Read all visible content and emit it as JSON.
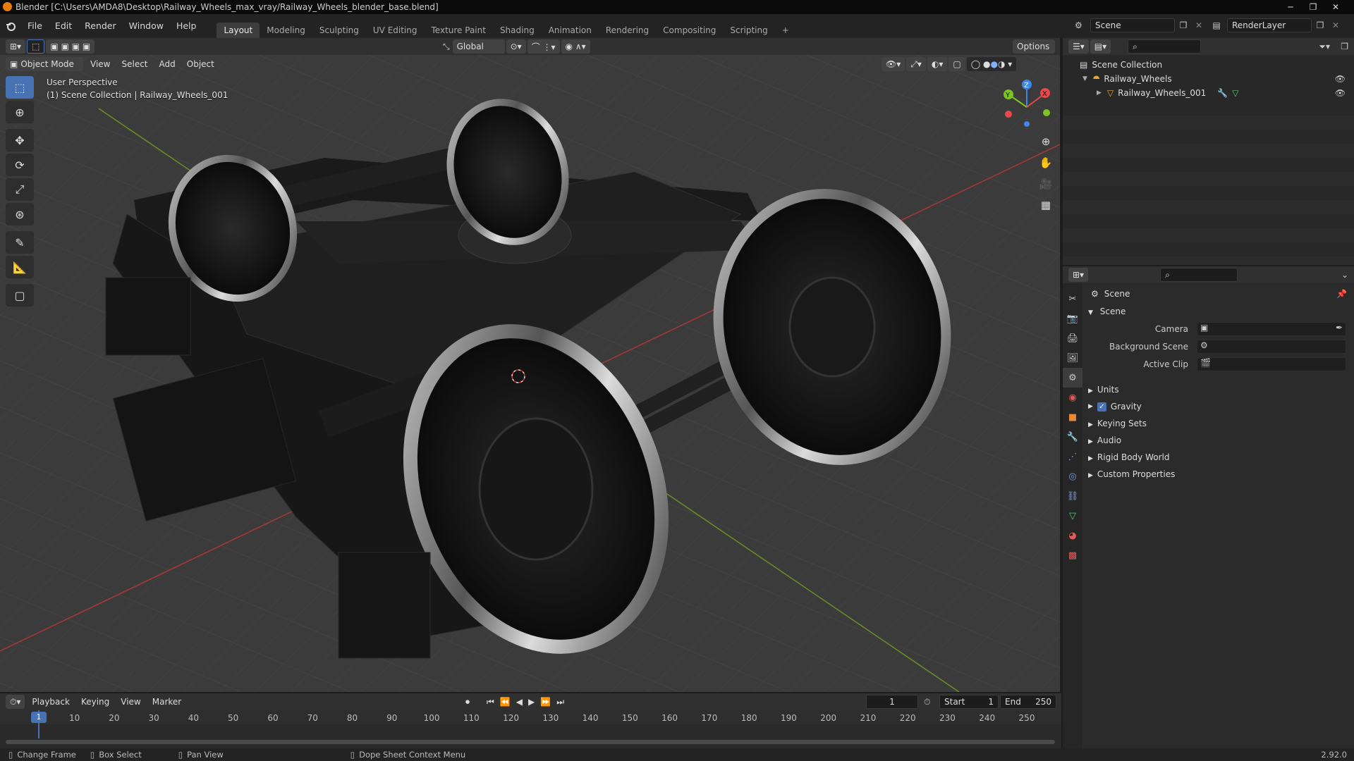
{
  "window": {
    "title": "Blender [C:\\Users\\AMDA8\\Desktop\\Railway_Wheels_max_vray/Railway_Wheels_blender_base.blend]",
    "controls": [
      "─",
      "❐",
      "✕"
    ]
  },
  "topbar": {
    "menus": [
      "File",
      "Edit",
      "Render",
      "Window",
      "Help"
    ],
    "workspaces": [
      "Layout",
      "Modeling",
      "Sculpting",
      "UV Editing",
      "Texture Paint",
      "Shading",
      "Animation",
      "Rendering",
      "Compositing",
      "Scripting"
    ],
    "active_workspace": "Layout",
    "add_workspace": "+",
    "scene_name": "Scene",
    "view_layer": "RenderLayer"
  },
  "viewport_header": {
    "orientation": "Global",
    "options": "Options",
    "mode": "Object Mode",
    "menus": [
      "View",
      "Select",
      "Add",
      "Object"
    ]
  },
  "viewport": {
    "perspective": "User Perspective",
    "collection_info": "(1) Scene Collection | Railway_Wheels_001",
    "gizmo_axes": {
      "x": "X",
      "y": "Y",
      "z": "Z"
    }
  },
  "outliner": {
    "root": "Scene Collection",
    "collection": "Railway_Wheels",
    "object": "Railway_Wheels_001"
  },
  "properties": {
    "context": "Scene",
    "panel": "Scene",
    "fields": [
      {
        "label": "Camera"
      },
      {
        "label": "Background Scene"
      },
      {
        "label": "Active Clip"
      }
    ],
    "sections": [
      "Units",
      "Gravity",
      "Keying Sets",
      "Audio",
      "Rigid Body World",
      "Custom Properties"
    ],
    "gravity_checked": true
  },
  "timeline": {
    "menus": [
      "Playback",
      "Keying",
      "View",
      "Marker"
    ],
    "current_frame": "1",
    "start_label": "Start",
    "start": "1",
    "end_label": "End",
    "end": "250",
    "ticks": [
      "1",
      "10",
      "20",
      "30",
      "40",
      "50",
      "60",
      "70",
      "80",
      "90",
      "100",
      "110",
      "120",
      "130",
      "140",
      "150",
      "160",
      "170",
      "180",
      "190",
      "200",
      "210",
      "220",
      "230",
      "240",
      "250"
    ]
  },
  "statusbar": {
    "items": [
      "Change Frame",
      "Box Select",
      "Pan View",
      "Dope Sheet Context Menu"
    ],
    "version": "2.92.0"
  },
  "colors": {
    "accent": "#4772b3",
    "axis_x": "#e84a4a",
    "axis_y": "#7cc520",
    "axis_z": "#3f86e8"
  }
}
